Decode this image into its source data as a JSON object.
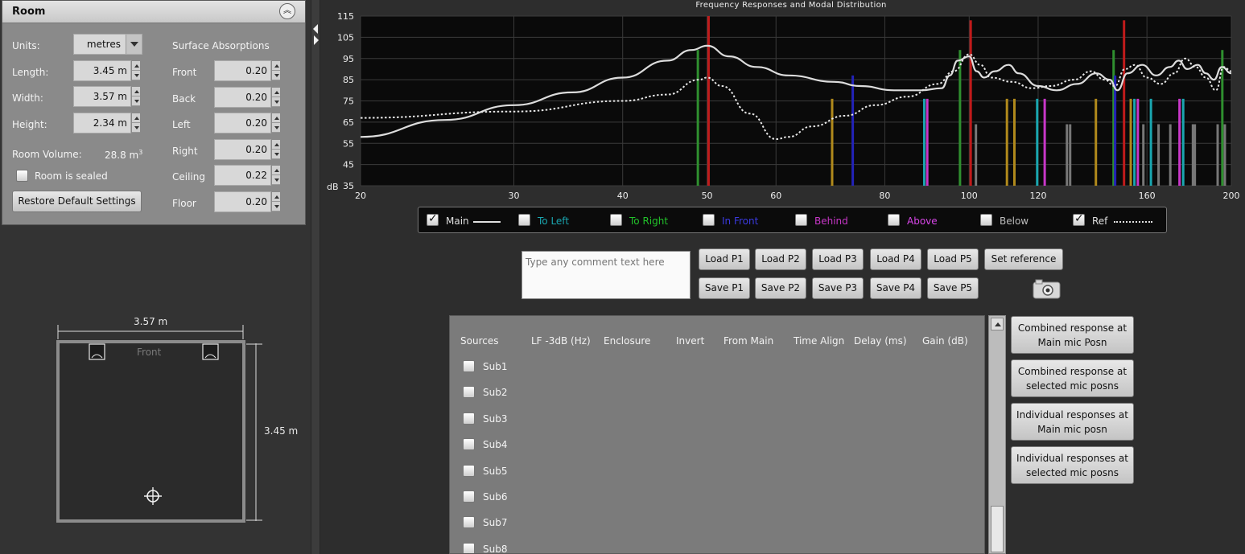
{
  "room": {
    "title": "Room",
    "units_label": "Units:",
    "units_value": "metres",
    "length_label": "Length:",
    "length_value": "3.45 m",
    "width_label": "Width:",
    "width_value": "3.57 m",
    "height_label": "Height:",
    "height_value": "2.34 m",
    "volume_label": "Room Volume:",
    "volume_value": "28.8 m",
    "volume_unit_sup": "3",
    "sealed_label": "Room is sealed",
    "sealed_checked": false,
    "restore_label": "Restore Default Settings",
    "absorptions_title": "Surface Absorptions",
    "absorptions": [
      {
        "label": "Front",
        "value": "0.20"
      },
      {
        "label": "Back",
        "value": "0.20"
      },
      {
        "label": "Left",
        "value": "0.20"
      },
      {
        "label": "Right",
        "value": "0.20"
      },
      {
        "label": "Ceiling",
        "value": "0.22"
      },
      {
        "label": "Floor",
        "value": "0.20"
      }
    ]
  },
  "diagram": {
    "width_label": "3.57 m",
    "length_label": "3.45 m",
    "front_label": "Front"
  },
  "legend": [
    {
      "label": "Main",
      "checked": true,
      "color": "#e0e0e0",
      "line": "solid"
    },
    {
      "label": "To Left",
      "checked": false,
      "color": "#1aa6b0",
      "line": ""
    },
    {
      "label": "To Right",
      "checked": false,
      "color": "#22c32a",
      "line": ""
    },
    {
      "label": "In Front",
      "checked": false,
      "color": "#3a3ae0",
      "line": ""
    },
    {
      "label": "Behind",
      "checked": false,
      "color": "#c837c8",
      "line": ""
    },
    {
      "label": "Above",
      "checked": false,
      "color": "#d846e8",
      "line": ""
    },
    {
      "label": "Below",
      "checked": false,
      "color": "#bdbdbd",
      "line": ""
    },
    {
      "label": "Ref",
      "checked": true,
      "color": "#e0e0e0",
      "line": "dotted"
    }
  ],
  "comment": {
    "placeholder": "Type any comment text here"
  },
  "preset_buttons": {
    "load": [
      "Load P1",
      "Load P2",
      "Load P3",
      "Load P4",
      "Load P5"
    ],
    "save": [
      "Save P1",
      "Save P2",
      "Save P3",
      "Save P4",
      "Save P5"
    ],
    "set_reference": "Set reference"
  },
  "subs": {
    "headers": [
      "Sources",
      "LF -3dB (Hz)",
      "Enclosure",
      "Invert",
      "From Main",
      "Time Align",
      "Delay (ms)",
      "Gain (dB)"
    ],
    "rows": [
      "Sub1",
      "Sub2",
      "Sub3",
      "Sub4",
      "Sub5",
      "Sub6",
      "Sub7",
      "Sub8"
    ]
  },
  "side_buttons": [
    "Combined response at Main mic Posn",
    "Combined response at selected mic posns",
    "Individual responses at Main mic posn",
    "Individual responses at selected mic posns"
  ],
  "chart_data": {
    "type": "line",
    "title": "Frequency Responses and Modal Distribution",
    "xlabel": "",
    "ylabel": "dB",
    "x_scale": "log",
    "xlim": [
      20,
      200
    ],
    "ylim": [
      35,
      115
    ],
    "x_ticks": [
      20,
      30,
      40,
      50,
      60,
      80,
      100,
      120,
      160,
      200
    ],
    "y_ticks": [
      35,
      45,
      55,
      65,
      75,
      85,
      95,
      105,
      115
    ],
    "grid": true,
    "series": [
      {
        "name": "Main",
        "style": "solid",
        "color": "#dcdcdc",
        "points": [
          [
            20,
            58
          ],
          [
            25,
            66
          ],
          [
            30,
            73
          ],
          [
            35,
            79
          ],
          [
            40,
            86
          ],
          [
            45,
            94
          ],
          [
            48,
            99
          ],
          [
            50,
            101
          ],
          [
            53,
            96
          ],
          [
            57,
            91
          ],
          [
            62,
            87
          ],
          [
            70,
            84
          ],
          [
            75,
            82
          ],
          [
            82,
            80
          ],
          [
            88,
            80
          ],
          [
            93,
            81
          ],
          [
            95,
            87
          ],
          [
            97,
            94
          ],
          [
            100,
            96
          ],
          [
            102,
            89
          ],
          [
            104,
            86
          ],
          [
            107,
            89
          ],
          [
            111,
            92
          ],
          [
            114,
            88
          ],
          [
            120,
            82
          ],
          [
            126,
            80
          ],
          [
            133,
            83
          ],
          [
            140,
            88
          ],
          [
            145,
            85
          ],
          [
            148,
            80
          ],
          [
            152,
            88
          ],
          [
            158,
            92
          ],
          [
            164,
            87
          ],
          [
            170,
            91
          ],
          [
            174,
            94
          ],
          [
            178,
            90
          ],
          [
            183,
            92
          ],
          [
            187,
            88
          ],
          [
            191,
            85
          ],
          [
            195,
            91
          ],
          [
            200,
            88
          ]
        ]
      },
      {
        "name": "Ref",
        "style": "dotted",
        "color": "#e6e6e6",
        "points": [
          [
            20,
            67
          ],
          [
            30,
            70
          ],
          [
            40,
            75
          ],
          [
            45,
            78
          ],
          [
            49,
            85
          ],
          [
            50,
            86
          ],
          [
            52,
            82
          ],
          [
            56,
            69
          ],
          [
            60,
            57
          ],
          [
            62,
            58
          ],
          [
            66,
            63
          ],
          [
            72,
            68
          ],
          [
            78,
            73
          ],
          [
            85,
            77
          ],
          [
            92,
            83
          ],
          [
            96,
            89
          ],
          [
            100,
            97
          ],
          [
            103,
            92
          ],
          [
            106,
            86
          ],
          [
            112,
            84
          ],
          [
            118,
            81
          ],
          [
            124,
            82
          ],
          [
            132,
            85
          ],
          [
            138,
            89
          ],
          [
            143,
            85
          ],
          [
            147,
            82
          ],
          [
            151,
            90
          ],
          [
            155,
            92
          ],
          [
            160,
            86
          ],
          [
            166,
            83
          ],
          [
            172,
            88
          ],
          [
            177,
            95
          ],
          [
            182,
            91
          ],
          [
            187,
            86
          ],
          [
            192,
            80
          ],
          [
            196,
            91
          ],
          [
            200,
            89
          ]
        ]
      }
    ],
    "modes": [
      {
        "f": 48.8,
        "top": 99,
        "color": "#2f8f2f"
      },
      {
        "f": 50.2,
        "top": 115,
        "color": "#c01b1b"
      },
      {
        "f": 69.6,
        "top": 76,
        "color": "#b18a1c"
      },
      {
        "f": 73.5,
        "top": 87,
        "color": "#2222b8"
      },
      {
        "f": 88.8,
        "top": 76,
        "color": "#1aa6b0"
      },
      {
        "f": 89.5,
        "top": 76,
        "color": "#c837c8"
      },
      {
        "f": 97.6,
        "top": 99,
        "color": "#2f8f2f"
      },
      {
        "f": 100.4,
        "top": 113,
        "color": "#c01b1b"
      },
      {
        "f": 101.8,
        "top": 64,
        "color": "#777777"
      },
      {
        "f": 110.5,
        "top": 76,
        "color": "#b18a1c"
      },
      {
        "f": 112.7,
        "top": 76,
        "color": "#b18a1c"
      },
      {
        "f": 119.7,
        "top": 76,
        "color": "#1aa6b0"
      },
      {
        "f": 122.1,
        "top": 76,
        "color": "#c837c8"
      },
      {
        "f": 129.5,
        "top": 64,
        "color": "#777777"
      },
      {
        "f": 130.6,
        "top": 64,
        "color": "#777777"
      },
      {
        "f": 139.8,
        "top": 76,
        "color": "#b18a1c"
      },
      {
        "f": 146.5,
        "top": 99,
        "color": "#2f8f2f"
      },
      {
        "f": 147.1,
        "top": 87,
        "color": "#2222b8"
      },
      {
        "f": 150.6,
        "top": 113,
        "color": "#c01b1b"
      },
      {
        "f": 153.3,
        "top": 76,
        "color": "#b18a1c"
      },
      {
        "f": 154.8,
        "top": 76,
        "color": "#1aa6b0"
      },
      {
        "f": 156.2,
        "top": 76,
        "color": "#c837c8"
      },
      {
        "f": 158.5,
        "top": 64,
        "color": "#777777"
      },
      {
        "f": 161.7,
        "top": 76,
        "color": "#1aa6b0"
      },
      {
        "f": 165.0,
        "top": 64,
        "color": "#777777"
      },
      {
        "f": 170.2,
        "top": 64,
        "color": "#777777"
      },
      {
        "f": 174.4,
        "top": 76,
        "color": "#c837c8"
      },
      {
        "f": 176.1,
        "top": 76,
        "color": "#1aa6b0"
      },
      {
        "f": 180.7,
        "top": 64,
        "color": "#777777"
      },
      {
        "f": 181.6,
        "top": 64,
        "color": "#777777"
      },
      {
        "f": 192.9,
        "top": 64,
        "color": "#777777"
      },
      {
        "f": 195.3,
        "top": 99,
        "color": "#2f8f2f"
      },
      {
        "f": 196.6,
        "top": 64,
        "color": "#777777"
      }
    ]
  }
}
